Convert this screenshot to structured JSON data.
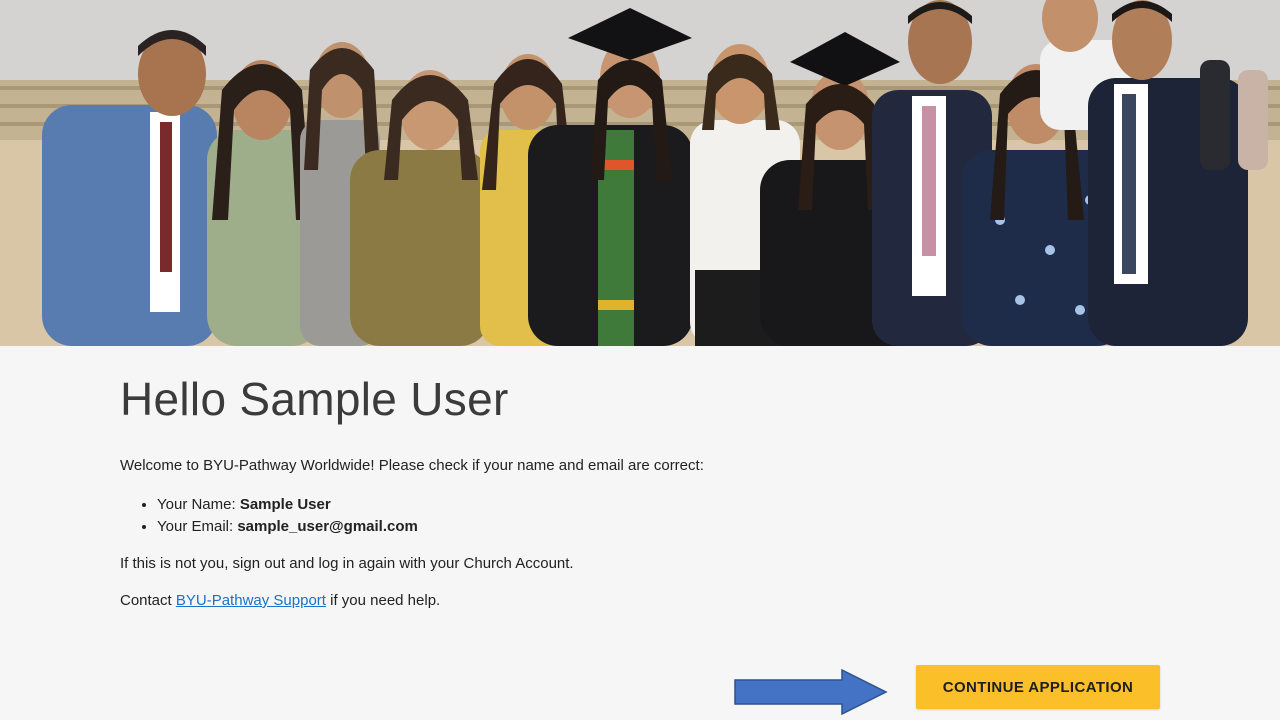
{
  "colors": {
    "page_background": "#f6f6f7",
    "button_background": "#fbbf2a",
    "link": "#1a73c8",
    "arrow": "#4472c4"
  },
  "hero": {
    "image": "group-photo-of-graduates-and-families"
  },
  "greeting": "Hello Sample User",
  "welcome_text": "Welcome to BYU-Pathway Worldwide! Please check if your name and email are correct:",
  "details": [
    {
      "label": "Your Name: ",
      "value": "Sample User"
    },
    {
      "label": "Your Email: ",
      "value": "sample_user@gmail.com"
    }
  ],
  "notice_text": "If this is not you, sign out and log in again with your Church Account.",
  "contact": {
    "prefix": "Contact ",
    "link_text": "BYU-Pathway Support",
    "suffix": " if you need help."
  },
  "continue_button_label": "CONTINUE APPLICATION",
  "arrow_icon": "arrow-right-icon"
}
